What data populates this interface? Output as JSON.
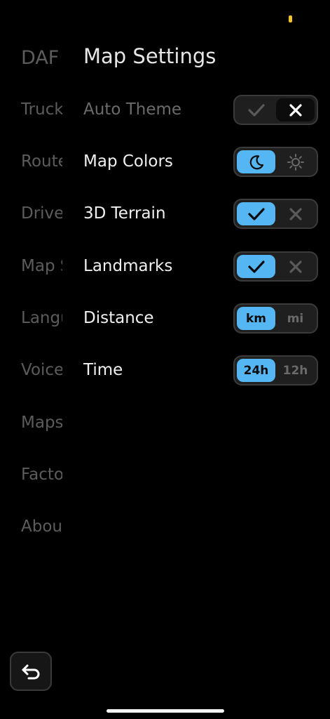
{
  "status": {
    "indicator_color": "#f5c518"
  },
  "sidebar": {
    "title": "DAF",
    "items": [
      {
        "label": "Trucks"
      },
      {
        "label": "Routes"
      },
      {
        "label": "Driver"
      },
      {
        "label": "Map Settings"
      },
      {
        "label": "Language"
      },
      {
        "label": "Voice"
      },
      {
        "label": "Maps"
      },
      {
        "label": "Factory"
      },
      {
        "label": "About"
      }
    ]
  },
  "page": {
    "title": "Map Settings"
  },
  "settings": {
    "auto_theme": {
      "label": "Auto Theme",
      "enabled": false,
      "value": "off",
      "icons": [
        "check-icon",
        "x-icon"
      ]
    },
    "map_colors": {
      "label": "Map Colors",
      "value": "night",
      "icons": [
        "moon-icon",
        "sun-icon"
      ]
    },
    "terrain_3d": {
      "label": "3D Terrain",
      "value": "on",
      "icons": [
        "check-icon",
        "x-icon"
      ]
    },
    "landmarks": {
      "label": "Landmarks",
      "value": "on",
      "icons": [
        "check-icon",
        "x-icon"
      ]
    },
    "distance": {
      "label": "Distance",
      "value": "km",
      "options": [
        "km",
        "mi"
      ]
    },
    "time": {
      "label": "Time",
      "value": "24h",
      "options": [
        "24h",
        "12h"
      ]
    }
  },
  "colors": {
    "accent": "#54b7f3",
    "background": "#000000",
    "inactive_text": "#5c5c5c"
  },
  "back_button": {
    "icon": "back-arrow-icon"
  }
}
